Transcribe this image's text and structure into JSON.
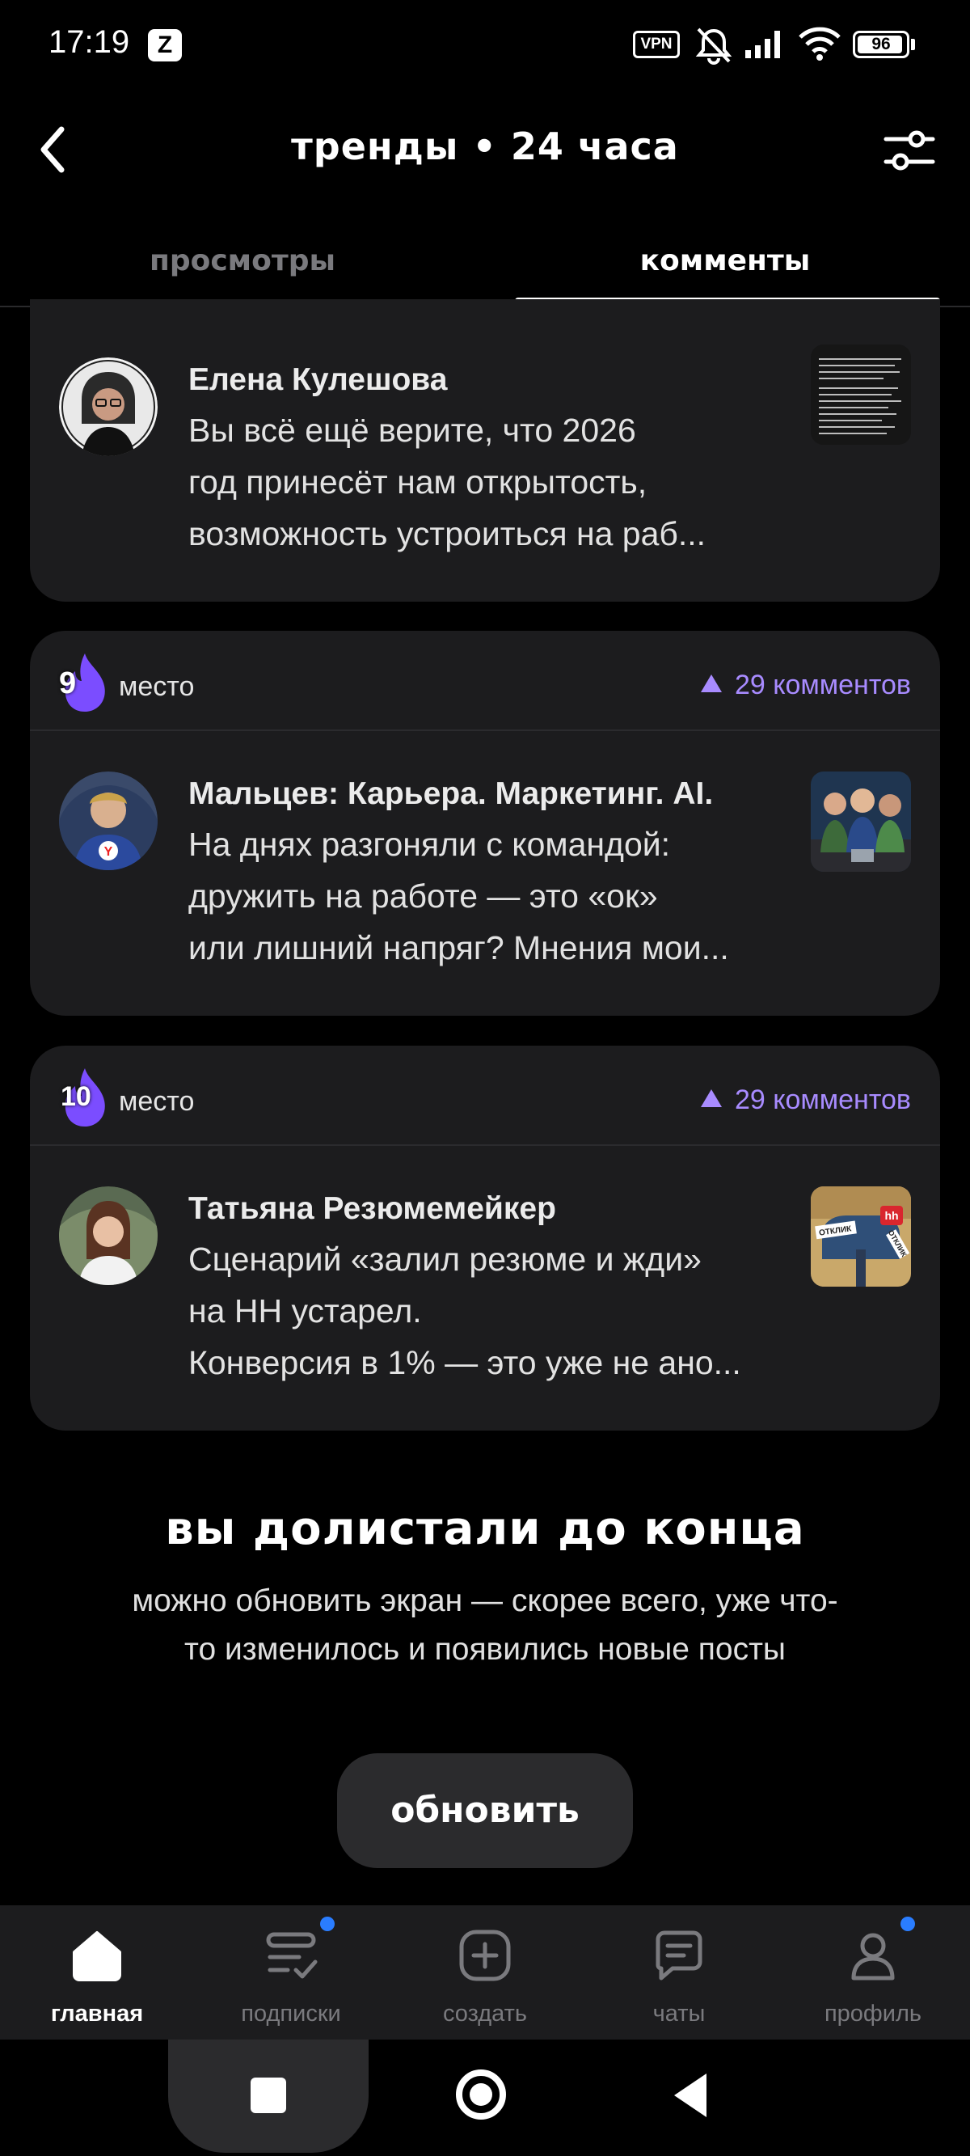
{
  "status_bar": {
    "time": "17:19",
    "app_badge": "Z",
    "vpn": "VPN",
    "battery": "96",
    "battery_level": 0.96
  },
  "header": {
    "title": "тренды • 24 часа"
  },
  "tabs": [
    {
      "label": "просмотры",
      "active": false
    },
    {
      "label": "комменты",
      "active": true
    }
  ],
  "posts": [
    {
      "author": "Елена Кулешова",
      "text": [
        "Вы всё ещё верите, что 2026",
        "год принесёт нам открытость,",
        "возможность устроиться на раб..."
      ]
    },
    {
      "rank": "9",
      "place_label": "место",
      "comments": "29 комментов",
      "author": "Мальцев: Карьера. Маркетинг. AI.",
      "text": [
        "На днях разгоняли с командой:",
        "дружить на работе — это «ок»",
        "или лишний напряг? Мнения мои..."
      ]
    },
    {
      "rank": "10",
      "place_label": "место",
      "comments": "29 комментов",
      "author": "Татьяна Резюмемейкер",
      "text": [
        "Сценарий «залил резюме и жди»",
        "на НН устарел.",
        "Конверсия в 1% — это уже не ано..."
      ]
    }
  ],
  "thumb_labels": {
    "tag1": "ОТКЛИК",
    "tag2": "hh",
    "tag3": "ОТКЛИК"
  },
  "end": {
    "title": "вы долистали до конца",
    "subtitle_line1": "можно обновить экран — скорее всего, уже что-",
    "subtitle_line2": "то изменилось и появились новые посты",
    "button": "обновить"
  },
  "nav": [
    {
      "label": "главная",
      "icon": "home-icon",
      "active": true,
      "badge": false
    },
    {
      "label": "подписки",
      "icon": "subscriptions-icon",
      "active": false,
      "badge": true
    },
    {
      "label": "создать",
      "icon": "create-plus-icon",
      "active": false,
      "badge": false
    },
    {
      "label": "чаты",
      "icon": "chat-icon",
      "active": false,
      "badge": false
    },
    {
      "label": "профиль",
      "icon": "profile-icon",
      "active": false,
      "badge": true
    }
  ],
  "colors": {
    "background": "#000000",
    "card": "#1c1c1e",
    "accent": "#a88bff",
    "flame": "#7b4dff",
    "badge_dot": "#2a7dff"
  }
}
